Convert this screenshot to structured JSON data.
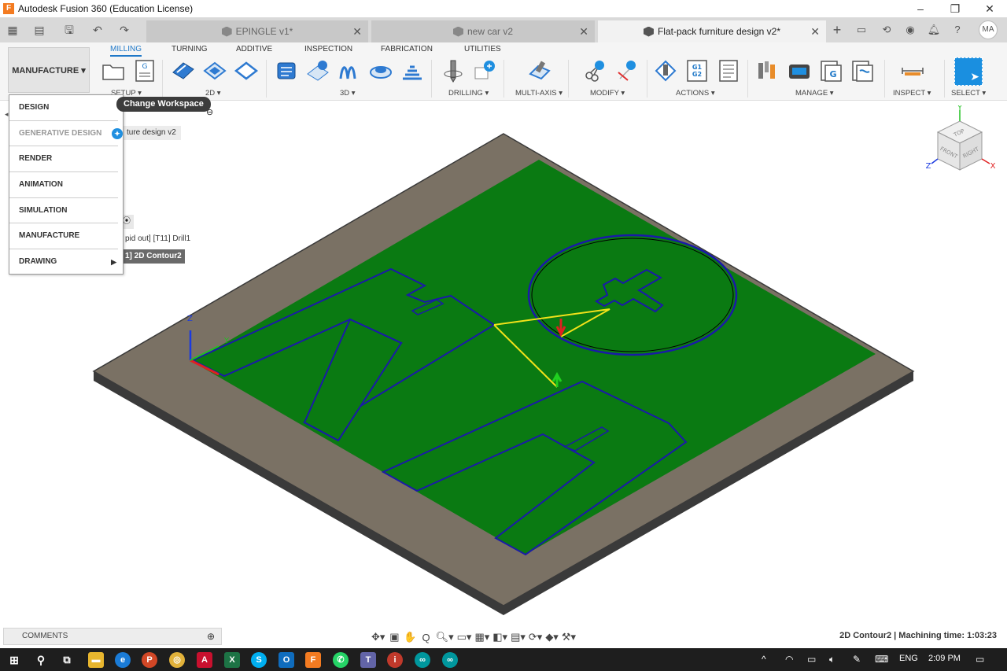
{
  "window": {
    "title": "Autodesk Fusion 360 (Education License)",
    "logo_letter": "F",
    "controls": {
      "minimize": "–",
      "restore": "❐",
      "close": "✕"
    }
  },
  "tabs": [
    {
      "label": "EPINGLE v1*",
      "active": false
    },
    {
      "label": "new car v2",
      "active": false
    },
    {
      "label": "Flat-pack furniture design v2*",
      "active": true
    }
  ],
  "quick_access": {
    "grid": "▦",
    "file": "▤",
    "save": "🖫",
    "undo": "↶",
    "redo": "↷",
    "new_tab": "+"
  },
  "user": {
    "initials": "MA"
  },
  "toolbar": {
    "workspace_label": "MANUFACTURE ▾",
    "subtabs": [
      "MILLING",
      "TURNING",
      "ADDITIVE",
      "INSPECTION",
      "FABRICATION",
      "UTILITIES"
    ],
    "active_subtab": "MILLING",
    "groups": {
      "setup": "SETUP ▾",
      "twod": "2D ▾",
      "threed": "3D ▾",
      "drilling": "DRILLING ▾",
      "multiaxis": "MULTI-AXIS ▾",
      "modify": "MODIFY ▾",
      "actions": "ACTIONS ▾",
      "manage": "MANAGE ▾",
      "inspect": "INSPECT ▾",
      "select": "SELECT ▾"
    },
    "g1g2": "G1 G2",
    "g_letter": "G"
  },
  "workspace_menu": {
    "items": [
      {
        "label": "DESIGN",
        "disabled": false
      },
      {
        "label": "GENERATIVE DESIGN",
        "disabled": true
      },
      {
        "label": "RENDER",
        "disabled": false
      },
      {
        "label": "ANIMATION",
        "disabled": false
      },
      {
        "label": "SIMULATION",
        "disabled": false
      },
      {
        "label": "MANUFACTURE",
        "disabled": false
      },
      {
        "label": "DRAWING",
        "disabled": false
      }
    ],
    "tooltip": "Change Workspace"
  },
  "browser": {
    "doc_name_fragment": "ture design v2",
    "row1_fragment": "pid out] [T11] Drill1",
    "row2_fragment": "1] 2D Contour2"
  },
  "viewcube": {
    "top": "TOP",
    "front": "FRONT",
    "right": "RIGHT",
    "axis_x": "X",
    "axis_y": "Y",
    "axis_z": "Z"
  },
  "scene_axis_labels": {
    "z": "Z",
    "y": "Y"
  },
  "bottom": {
    "comments_label": "COMMENTS",
    "status": "2D Contour2 | Machining time: 1:03:23"
  },
  "taskbar": {
    "language": "ENG",
    "time": "2:09 PM"
  },
  "colors": {
    "stock_top": "#7a7164",
    "sheet_green": "#0a7a12",
    "toolpath_blue": "#1a1aa8",
    "rapid_yellow": "#f2e21a",
    "accent_blue": "#1f78c8",
    "taskbar": "#1e1e1e"
  }
}
